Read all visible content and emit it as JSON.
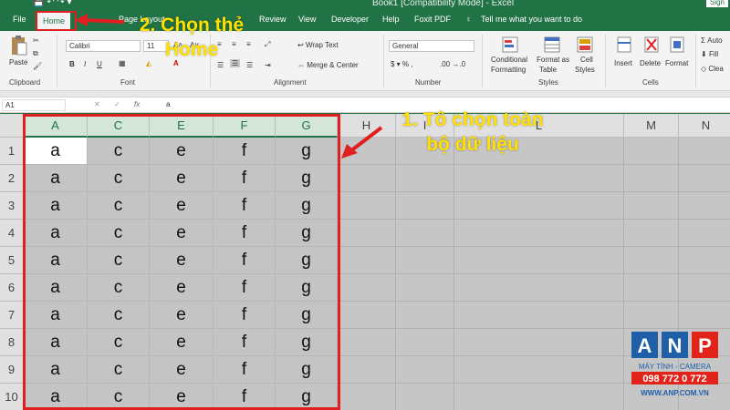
{
  "window": {
    "title": "Book1  [Compatibility Mode]  -  Excel",
    "signin_label": "Sign"
  },
  "tabs": [
    {
      "label": "File"
    },
    {
      "label": "Home"
    },
    {
      "label": "Page Layout"
    },
    {
      "label": "Review"
    },
    {
      "label": "View"
    },
    {
      "label": "Developer"
    },
    {
      "label": "Help"
    },
    {
      "label": "Foxit PDF"
    }
  ],
  "tell_me": "Tell me what you want to do",
  "ribbon": {
    "clipboard": {
      "paste": "Paste",
      "label": "Clipboard"
    },
    "font": {
      "name": "Calibri",
      "bold": "B",
      "italic": "I",
      "underline": "U",
      "label": "Font"
    },
    "alignment": {
      "wrap": "Wrap Text",
      "merge": "Merge & Center",
      "label": "Alignment"
    },
    "number": {
      "format": "General",
      "label": "Number"
    },
    "styles": {
      "conditional_1": "Conditional",
      "conditional_2": "Formatting",
      "format_table_1": "Format as",
      "format_table_2": "Table",
      "cell_styles_1": "Cell",
      "cell_styles_2": "Styles",
      "label": "Styles"
    },
    "cells": {
      "insert": "Insert",
      "delete": "Delete",
      "format": "Format",
      "label": "Cells"
    },
    "editing": {
      "autosum": "Auto",
      "fill": "Fill",
      "clear": "Clea"
    }
  },
  "formula_bar": {
    "name_box": "A1",
    "fx": "fx",
    "value": "a"
  },
  "sheet": {
    "selected_columns": [
      "A",
      "C",
      "E",
      "F",
      "G"
    ],
    "other_columns": [
      "H",
      "I",
      "L",
      "M",
      "N"
    ],
    "rows": [
      "1",
      "2",
      "3",
      "4",
      "5",
      "6",
      "7",
      "8",
      "9",
      "10"
    ],
    "cell_values": [
      "a",
      "c",
      "e",
      "f",
      "g"
    ]
  },
  "annotations": {
    "step2_line1": "2. Chọn thẻ",
    "step2_line2": "Home",
    "step1_line1": "1. Tô chọn toàn",
    "step1_line2": "bộ dữ liệu"
  },
  "logo": {
    "letters": [
      "A",
      "N",
      "P"
    ],
    "tagline": "MÁY TÍNH - CAMERA",
    "phone": "098 772 0 772",
    "website": "WWW.ANP.COM.VN"
  },
  "colors": {
    "excel_green": "#217346",
    "annotation_red": "#e02020",
    "annotation_yellow": "#ffe000",
    "logo_blue": "#1f5fa8",
    "logo_red": "#e2231a"
  }
}
